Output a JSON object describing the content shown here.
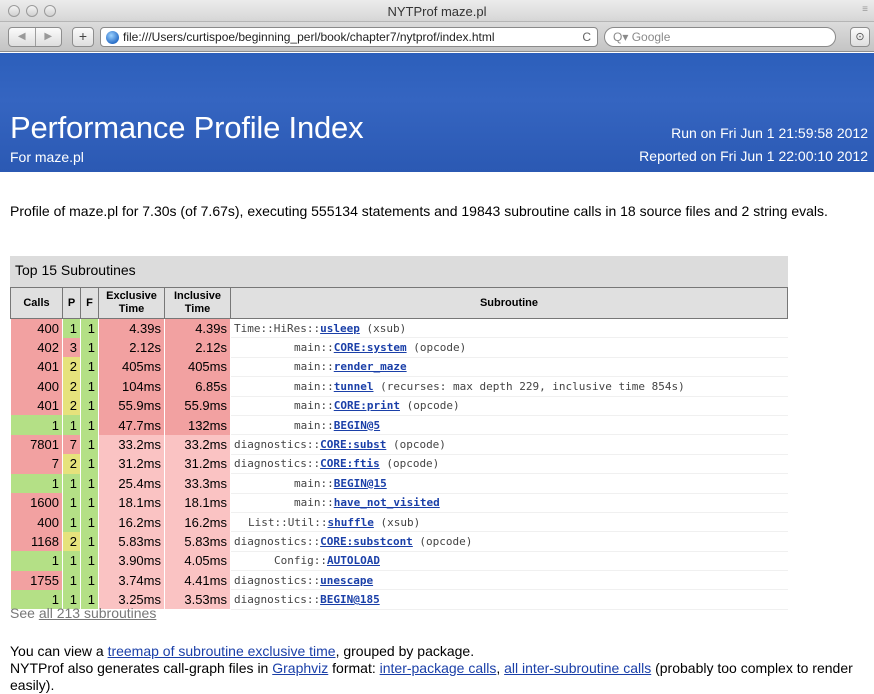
{
  "window": {
    "title": "NYTProf maze.pl",
    "corner": "≡"
  },
  "toolbar": {
    "url": "file:///Users/curtispoe/beginning_perl/book/chapter7/nytprof/index.html",
    "reload_icon": "C",
    "search_placeholder": "Q▾ Google",
    "add_label": "+"
  },
  "header": {
    "title": "Performance Profile Index",
    "subtitle": "For maze.pl",
    "run_on": "Run on Fri Jun 1 21:59:58 2012",
    "reported_on": "Reported on Fri Jun 1 22:00:10 2012"
  },
  "summary": "Profile of maze.pl for 7.30s (of 7.67s), executing 555134 statements and 19843 subroutine calls in 18 source files and 2 string evals.",
  "table": {
    "caption": "Top 15 Subroutines",
    "headers": [
      "Calls",
      "P",
      "F",
      "Exclusive Time",
      "Inclusive Time",
      "Subroutine"
    ],
    "rows": [
      {
        "calls": "400",
        "p": "1",
        "f": "1",
        "excl": "4.39s",
        "incl": "4.39s",
        "pkg": "Time::HiRes::",
        "name": "usleep",
        "note": " (xsub)",
        "indent": 0
      },
      {
        "calls": "402",
        "p": "3",
        "f": "1",
        "excl": "2.12s",
        "incl": "2.12s",
        "pkg": "main::",
        "name": "CORE:system",
        "note": " (opcode)",
        "indent": 1
      },
      {
        "calls": "401",
        "p": "2",
        "f": "1",
        "excl": "405ms",
        "incl": "405ms",
        "pkg": "main::",
        "name": "render_maze",
        "note": "",
        "indent": 1
      },
      {
        "calls": "400",
        "p": "2",
        "f": "1",
        "excl": "104ms",
        "incl": "6.85s",
        "pkg": "main::",
        "name": "tunnel",
        "note": " (recurses: max depth 229, inclusive time 854s)",
        "indent": 1
      },
      {
        "calls": "401",
        "p": "2",
        "f": "1",
        "excl": "55.9ms",
        "incl": "55.9ms",
        "pkg": "main::",
        "name": "CORE:print",
        "note": " (opcode)",
        "indent": 1
      },
      {
        "calls": "1",
        "p": "1",
        "f": "1",
        "excl": "47.7ms",
        "incl": "132ms",
        "pkg": "main::",
        "name": "BEGIN@5",
        "note": "",
        "indent": 1
      },
      {
        "calls": "7801",
        "p": "7",
        "f": "1",
        "excl": "33.2ms",
        "incl": "33.2ms",
        "pkg": "diagnostics::",
        "name": "CORE:subst",
        "note": " (opcode)",
        "indent": 0
      },
      {
        "calls": "7",
        "p": "2",
        "f": "1",
        "excl": "31.2ms",
        "incl": "31.2ms",
        "pkg": "diagnostics::",
        "name": "CORE:ftis",
        "note": " (opcode)",
        "indent": 0
      },
      {
        "calls": "1",
        "p": "1",
        "f": "1",
        "excl": "25.4ms",
        "incl": "33.3ms",
        "pkg": "main::",
        "name": "BEGIN@15",
        "note": "",
        "indent": 1
      },
      {
        "calls": "1600",
        "p": "1",
        "f": "1",
        "excl": "18.1ms",
        "incl": "18.1ms",
        "pkg": "main::",
        "name": "have_not_visited",
        "note": "",
        "indent": 1
      },
      {
        "calls": "400",
        "p": "1",
        "f": "1",
        "excl": "16.2ms",
        "incl": "16.2ms",
        "pkg": "List::Util::",
        "name": "shuffle",
        "note": " (xsub)",
        "indent": 2
      },
      {
        "calls": "1168",
        "p": "2",
        "f": "1",
        "excl": "5.83ms",
        "incl": "5.83ms",
        "pkg": "diagnostics::",
        "name": "CORE:substcont",
        "note": " (opcode)",
        "indent": 0
      },
      {
        "calls": "1",
        "p": "1",
        "f": "1",
        "excl": "3.90ms",
        "incl": "4.05ms",
        "pkg": "Config::",
        "name": "AUTOLOAD",
        "note": "",
        "indent": 3
      },
      {
        "calls": "1755",
        "p": "1",
        "f": "1",
        "excl": "3.74ms",
        "incl": "4.41ms",
        "pkg": "diagnostics::",
        "name": "unescape",
        "note": "",
        "indent": 0
      },
      {
        "calls": "1",
        "p": "1",
        "f": "1",
        "excl": "3.25ms",
        "incl": "3.53ms",
        "pkg": "diagnostics::",
        "name": "BEGIN@185",
        "note": "",
        "indent": 0
      }
    ]
  },
  "see_all": {
    "prefix": "See ",
    "link": "all 213 subroutines"
  },
  "treemap": {
    "prefix": "You can view a ",
    "link": "treemap of subroutine exclusive time",
    "suffix": ", grouped by package."
  },
  "callgraph": {
    "prefix": "NYTProf also generates call-graph files in ",
    "link1": "Graphviz",
    "mid": " format: ",
    "link2": "inter-package calls",
    "sep": ", ",
    "link3": "all inter-subroutine calls",
    "suffix": " (probably too complex to render easily)."
  },
  "colors": {
    "banner": "#2c5fbb",
    "red": "#f2a1a1",
    "yellow": "#e6e27c",
    "green": "#b4e086"
  }
}
